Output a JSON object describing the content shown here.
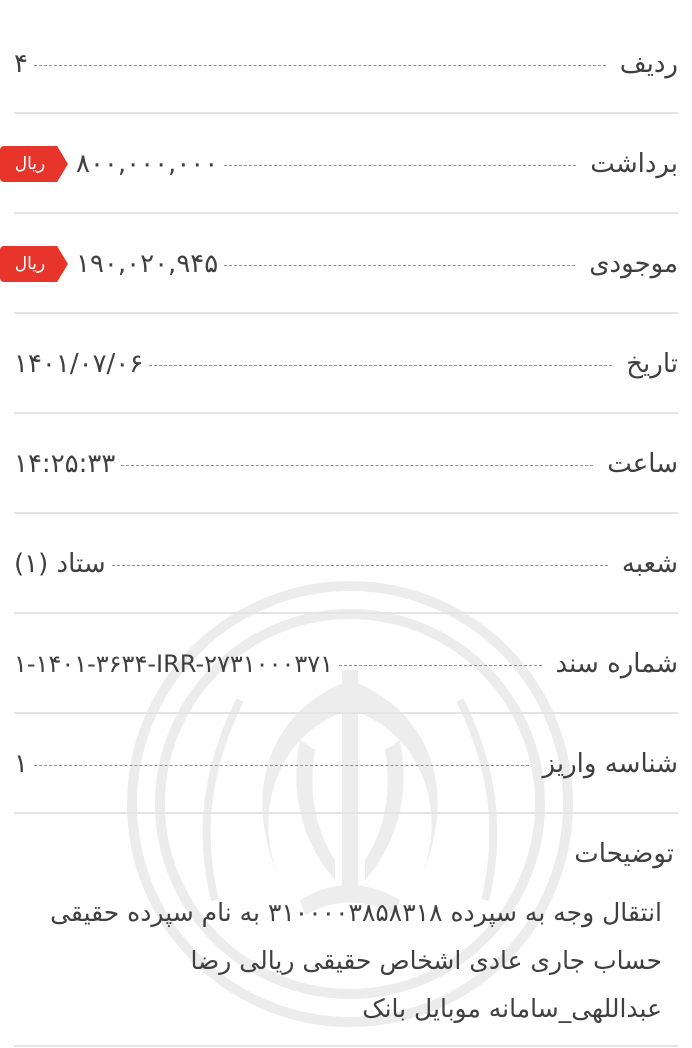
{
  "rows": [
    {
      "label": "ردیف",
      "value": "۴",
      "badge": ""
    },
    {
      "label": "برداشت",
      "value": "۸۰۰,۰۰۰,۰۰۰",
      "badge": "ریال"
    },
    {
      "label": "موجودی",
      "value": "۱۹۰,۰۲۰,۹۴۵",
      "badge": "ریال"
    },
    {
      "label": "تاریخ",
      "value": "۱۴۰۱/۰۷/۰۶",
      "badge": ""
    },
    {
      "label": "ساعت",
      "value": "۱۴:۲۵:۳۳",
      "badge": ""
    },
    {
      "label": "شعبه",
      "value": "ستاد (۱)",
      "badge": ""
    },
    {
      "label": "شماره سند",
      "value": "۱-۱۴۰۱-۳۶۳۴-IRR-۲۷۳۱۰۰۰۳۷۱",
      "badge": ""
    },
    {
      "label": "شناسه واریز",
      "value": "۱",
      "badge": ""
    }
  ],
  "description": {
    "title": "توضیحات",
    "text": "انتقال وجه به سپرده ۳۱۰۰۰۰۳۸۵۸۳۱۸ به نام سپرده حقیقی حساب جاری عادی اشخاص حقیقی ریالی رضا عبداللهی_سامانه موبایل بانک"
  },
  "colors": {
    "accent_leader": "#2ab9c9",
    "badge": "#e8352b",
    "divider": "#e4e4e4"
  },
  "icons": {
    "watermark": "bank-emblem-watermark-icon"
  }
}
